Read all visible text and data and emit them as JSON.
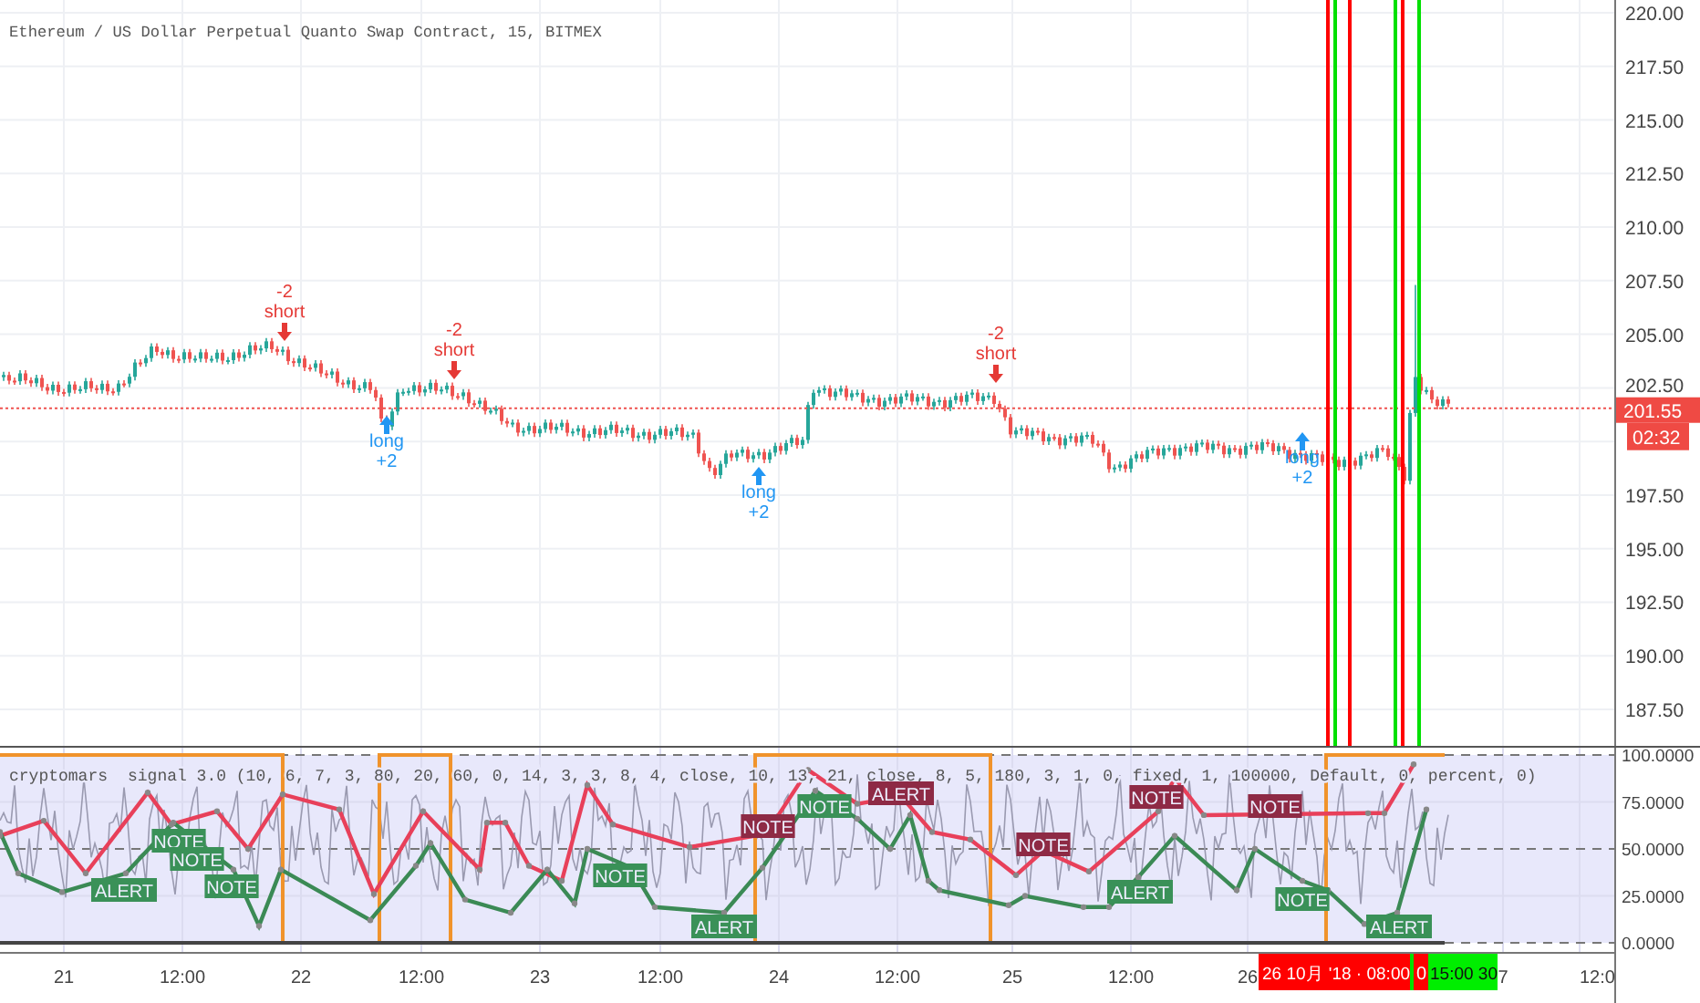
{
  "chart": {
    "title": "Ethereum / US Dollar Perpetual Quanto Swap Contract, 15, BITMEX"
  },
  "signals": [
    {
      "kind": "short",
      "amount": "-2",
      "label": "short"
    },
    {
      "kind": "long",
      "label": "long",
      "amount": "+2"
    },
    {
      "kind": "short",
      "amount": "-2",
      "label": "short"
    },
    {
      "kind": "long",
      "label": "long",
      "amount": "+2"
    },
    {
      "kind": "short",
      "amount": "-2",
      "label": "short"
    },
    {
      "kind": "long",
      "label": "long",
      "amount": "+2"
    }
  ],
  "price_axis": {
    "ticks": [
      "220.00",
      "217.50",
      "215.00",
      "212.50",
      "210.00",
      "207.50",
      "205.00",
      "202.50",
      "197.50",
      "195.00",
      "192.50",
      "190.00",
      "187.50"
    ],
    "last_price": "201.55",
    "countdown": "02:32"
  },
  "indicator": {
    "name": "cryptomars",
    "params": "signal 3.0 (10, 6, 7, 3, 80, 20, 60, 0, 14, 3, 3, 8, 4, close, 10, 13, 21, close, 8, 5, 180, 3, 1, 0, fixed, 1, 100000, Default, 0, percent, 0)",
    "ticks": [
      "100.0000",
      "75.0000",
      "50.0000",
      "25.0000",
      "0.0000"
    ],
    "badges": [
      {
        "text": "ALERT",
        "color": "#3a9158"
      },
      {
        "text": "NOTE",
        "color": "#3a9158"
      },
      {
        "text": "NOTE",
        "color": "#3a9158"
      },
      {
        "text": "NOTE",
        "color": "#3a9158"
      },
      {
        "text": "NOTE",
        "color": "#3a9158"
      },
      {
        "text": "ALERT",
        "color": "#3a9158"
      },
      {
        "text": "NOTE",
        "color": "#8e2a45"
      },
      {
        "text": "NOTE",
        "color": "#3a9158"
      },
      {
        "text": "ALERT",
        "color": "#8e2a45"
      },
      {
        "text": "NOTE",
        "color": "#8e2a45"
      },
      {
        "text": "ALERT",
        "color": "#3a9158"
      },
      {
        "text": "NOTE",
        "color": "#8e2a45"
      },
      {
        "text": "NOTE",
        "color": "#8e2a45"
      },
      {
        "text": "NOTE",
        "color": "#3a9158"
      },
      {
        "text": "ALERT",
        "color": "#3a9158"
      }
    ]
  },
  "time_axis": {
    "labels": [
      "21",
      "12:00",
      "22",
      "12:00",
      "23",
      "12:00",
      "24",
      "12:00",
      "25",
      "12:00",
      "26",
      "7",
      "12:0"
    ],
    "cursor_date": "26 10月 '18 · 08:00",
    "cursor_mid": "0",
    "cursor_time": "15:00 30"
  }
}
